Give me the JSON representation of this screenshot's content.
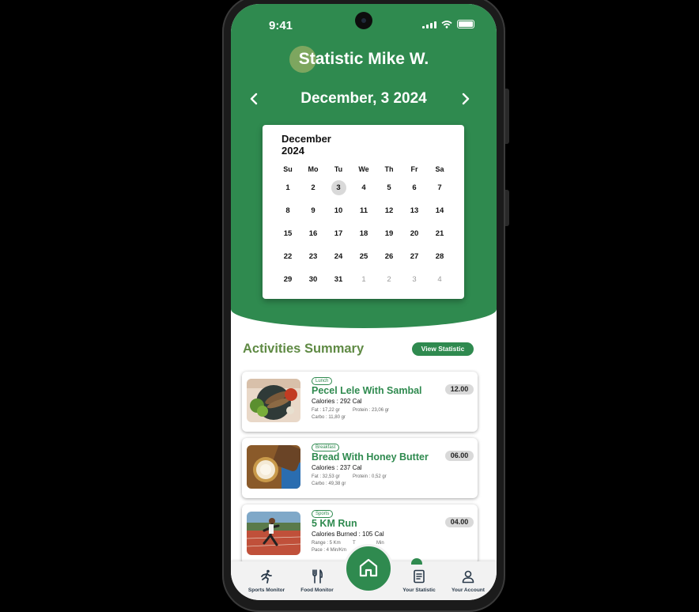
{
  "status_bar": {
    "time": "9:41"
  },
  "header": {
    "title": "Statistic Mike W.",
    "date": "December, 3 2024"
  },
  "calendar": {
    "month": "December",
    "year": "2024",
    "weekdays": [
      "Su",
      "Mo",
      "Tu",
      "We",
      "Th",
      "Fr",
      "Sa"
    ],
    "days": [
      "1",
      "2",
      "3",
      "4",
      "5",
      "6",
      "7",
      "8",
      "9",
      "10",
      "11",
      "12",
      "13",
      "14",
      "15",
      "16",
      "17",
      "18",
      "19",
      "20",
      "21",
      "22",
      "23",
      "24",
      "25",
      "26",
      "27",
      "28",
      "29",
      "30",
      "31"
    ],
    "next_month_days": [
      "1",
      "2",
      "3",
      "4"
    ],
    "selected_day": "3"
  },
  "activities": {
    "title": "Activities Summary",
    "view_button": "View Statistic",
    "items": [
      {
        "tag": "Lunch",
        "name": "Pecel Lele With Sambal",
        "calories": "Calories : 292 Cal",
        "detail1": "Fat : 17,22 gr",
        "detail2": "Protein : 23,06 gr",
        "detail3": "Carbo : 11,80 gr",
        "time": "12.00"
      },
      {
        "tag": "Breakfast",
        "name": "Bread With Honey Butter",
        "calories": "Calories : 237 Cal",
        "detail1": "Fat : 32,53 gr",
        "detail2": "Protein : 0,52 gr",
        "detail3": "Carbo : 49,38 gr",
        "time": "06.00"
      },
      {
        "tag": "Sports",
        "name": "5 KM Run",
        "calories": "Calories Burned : 105 Cal",
        "detail1": "Range : 5 Km",
        "detail2": "T",
        "detail3": "Pace : 4 Min/Km",
        "detail4": "Min",
        "time": "04.00"
      }
    ]
  },
  "bottom_nav": {
    "items": [
      {
        "label": "Sports Monitor",
        "icon": "runner-icon"
      },
      {
        "label": "Food Monitor",
        "icon": "fork-knife-icon"
      },
      {
        "label": "",
        "icon": "home-icon"
      },
      {
        "label": "Your Statistic",
        "icon": "document-icon"
      },
      {
        "label": "Your Account",
        "icon": "user-icon"
      }
    ]
  },
  "colors": {
    "primary": "#2f8a4f",
    "title_accent": "#5f8a44",
    "badge": "#d9d9d9"
  }
}
